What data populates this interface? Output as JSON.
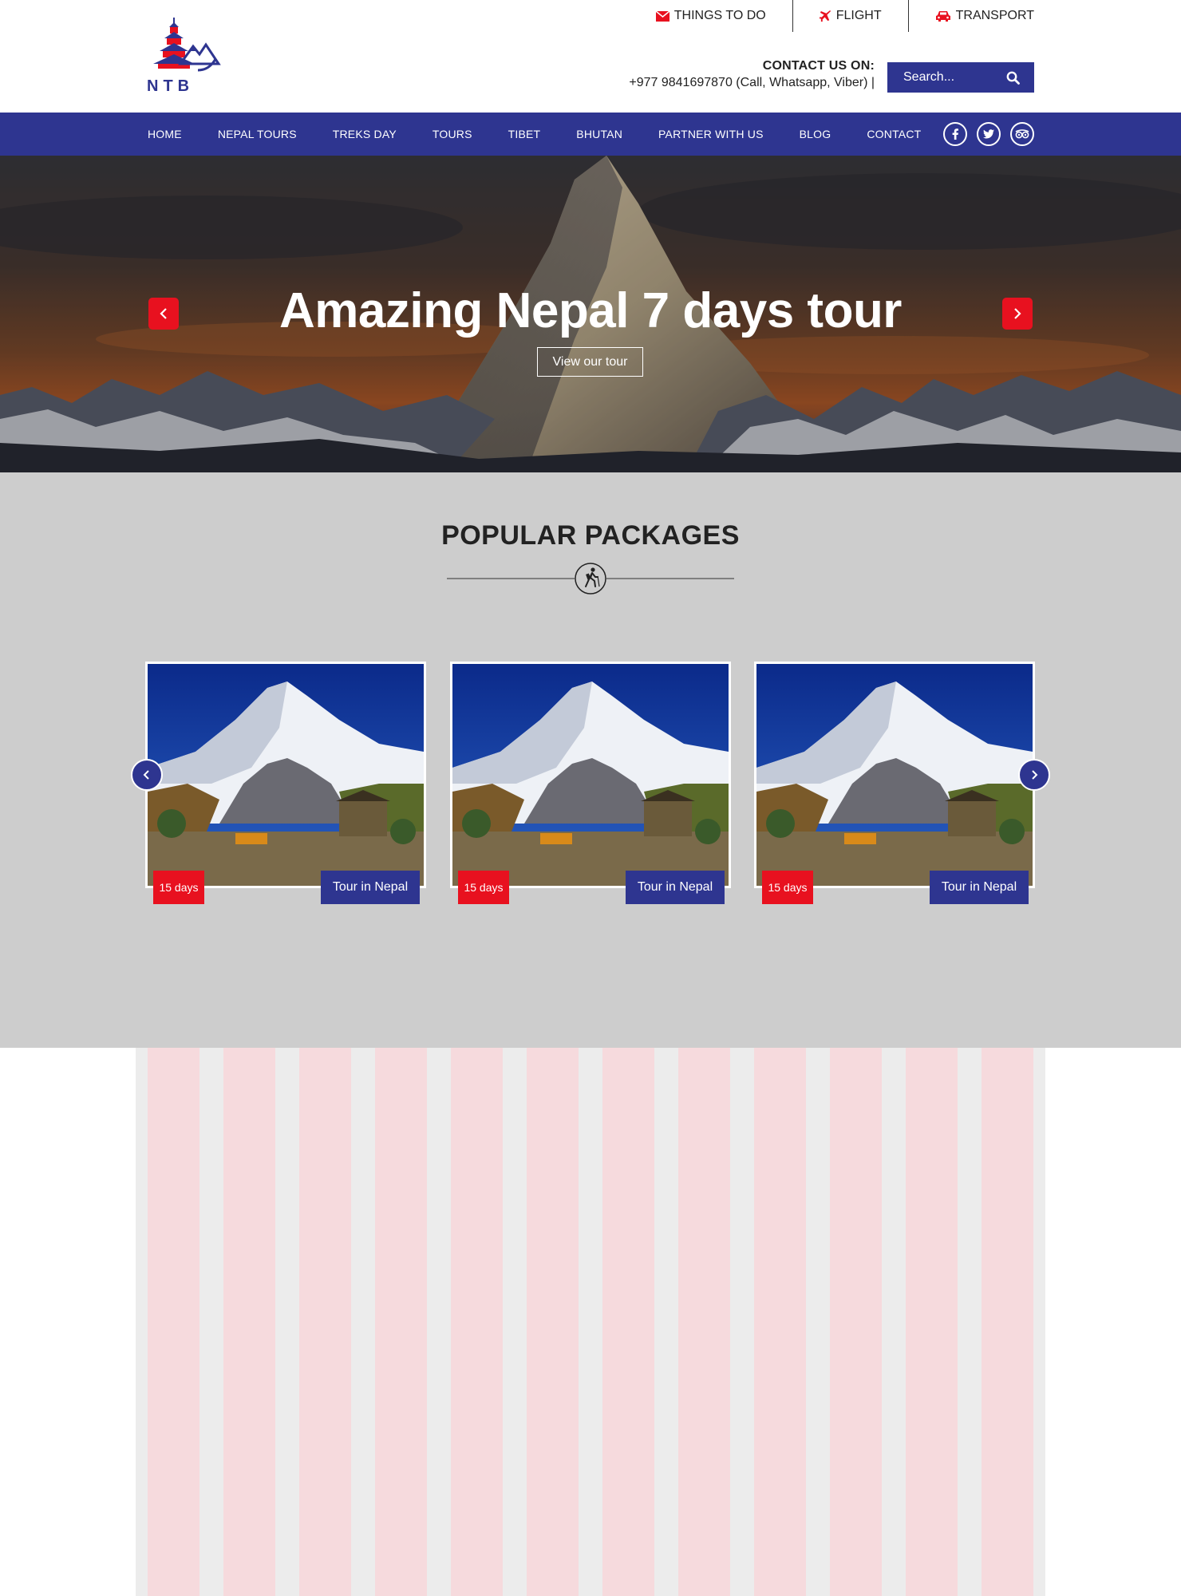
{
  "util_links": [
    {
      "label": "THINGS TO DO",
      "icon": "envelope-icon"
    },
    {
      "label": "FLIGHT",
      "icon": "plane-icon"
    },
    {
      "label": "TRANSPORT",
      "icon": "car-icon"
    }
  ],
  "contact": {
    "label": "CONTACT US ON:",
    "number": "+977 9841697870 (Call, Whatsapp, Viber) |"
  },
  "search": {
    "placeholder": "Search..."
  },
  "logo": {
    "text": "NTB"
  },
  "nav": [
    "HOME",
    "NEPAL TOURS",
    "TREKS DAY",
    "TOURS",
    "TIBET",
    "BHUTAN",
    "PARTNER WITH US",
    "BLOG",
    "CONTACT"
  ],
  "social": [
    "facebook-icon",
    "twitter-icon",
    "tripadvisor-icon"
  ],
  "hero": {
    "title": "Amazing Nepal 7 days tour",
    "button": "View our tour"
  },
  "popular": {
    "title": "POPULAR PACKAGES",
    "cards": [
      {
        "days": "15 days",
        "name": "Tour in Nepal"
      },
      {
        "days": "15 days",
        "name": "Tour in Nepal"
      },
      {
        "days": "15 days",
        "name": "Tour in Nepal"
      }
    ]
  },
  "colors": {
    "brand_blue": "#2e3590",
    "accent_red": "#e8111f",
    "section_gray": "#cdcdcd",
    "grid_pink": "#f6dadd"
  }
}
